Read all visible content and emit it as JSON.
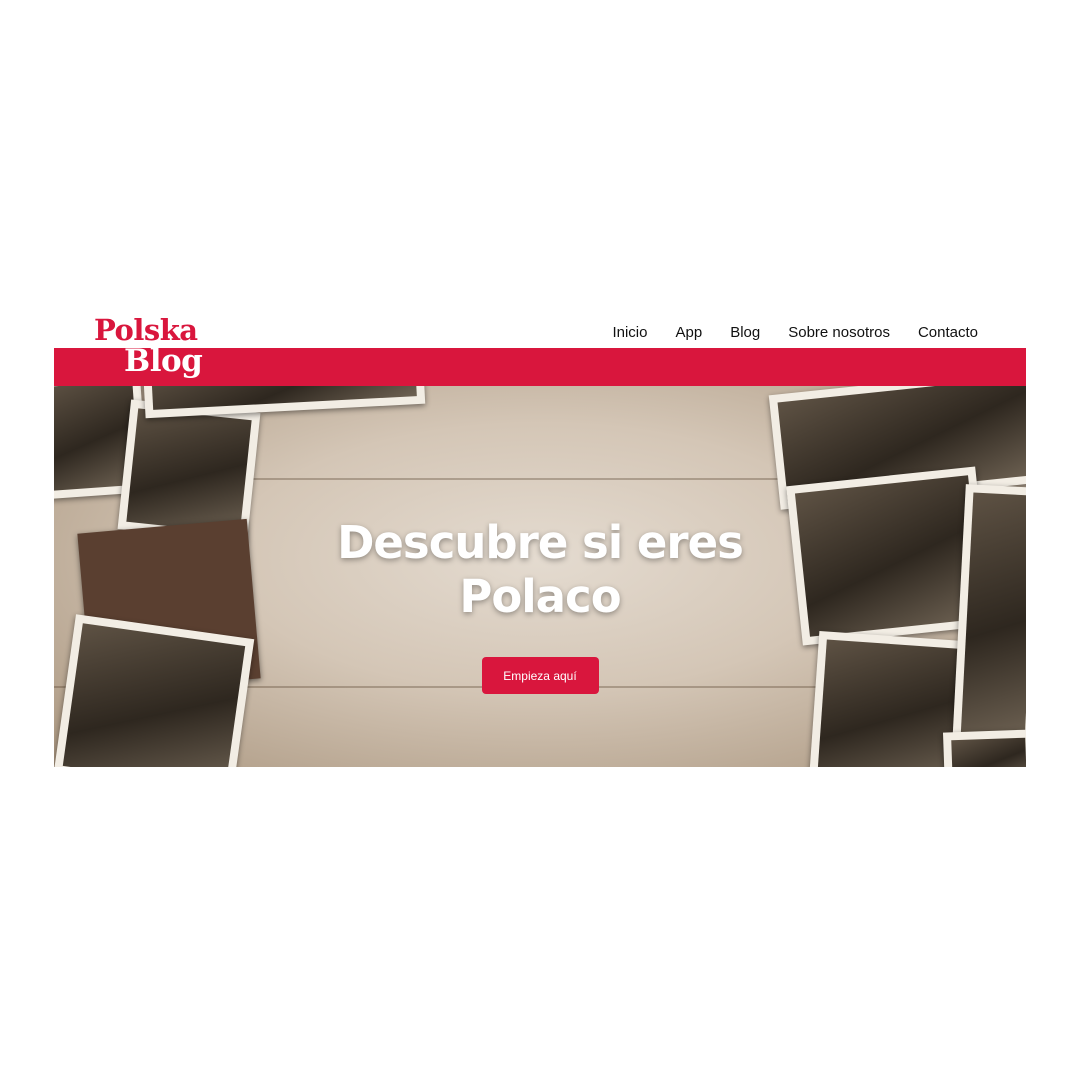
{
  "brand": {
    "line1": "Polska",
    "line2": "Blog",
    "accent_color": "#d9163d"
  },
  "nav": {
    "items": [
      {
        "label": "Inicio"
      },
      {
        "label": "App"
      },
      {
        "label": "Blog"
      },
      {
        "label": "Sobre nosotros"
      },
      {
        "label": "Contacto"
      }
    ]
  },
  "hero": {
    "title": "Descubre si eres Polaco",
    "cta_label": "Empieza aquí",
    "background": "vintage-photos-on-wood-image"
  }
}
